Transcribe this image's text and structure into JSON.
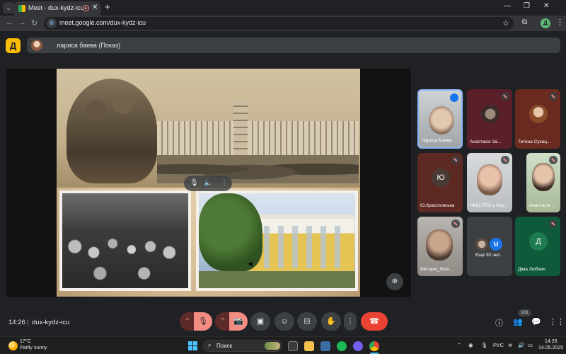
{
  "browser": {
    "tab_title": "Meet - dux-kydz-icu",
    "url": "meet.google.com/dux-kydz-icu",
    "profile_initial": "Д",
    "window_controls": [
      "—",
      "❐",
      "✕"
    ]
  },
  "meet": {
    "logo_letter": "Д",
    "presenter_label": "лариса баева (Показ)",
    "meeting_time": "14:26",
    "divider": "|",
    "meeting_code": "dux-kydz-icu",
    "participant_count": "101",
    "participants": [
      {
        "name": "Лариса Баева",
        "status": "speaking"
      },
      {
        "name": "Анастасія За...",
        "status": "muted"
      },
      {
        "name": "Тетяна Сухац...",
        "status": "muted"
      },
      {
        "name": "Ю.Красіловська",
        "initial": "Ю",
        "status": "muted"
      },
      {
        "name": "НМЦ ПТО у Хар...",
        "status": "muted"
      },
      {
        "name": "Анастасія ...",
        "status": "muted"
      },
      {
        "name": "Вікторія_Жов...",
        "status": "muted"
      },
      {
        "name": "Ещё 92 чел.",
        "initial": "M"
      },
      {
        "name": "Діма Любчич",
        "initial": "Д",
        "status": "muted"
      }
    ]
  },
  "taskbar": {
    "weather_temp": "17°C",
    "weather_desc": "Partly sunny",
    "search_placeholder": "Поиск",
    "language": "РУС",
    "time": "14:26",
    "date": "14.05.2025"
  },
  "colors": {
    "end_call": "#ea4335",
    "muted_red": "#f28b82",
    "meet_logo": "#fbbc04",
    "accent_blue": "#1a73e8"
  }
}
